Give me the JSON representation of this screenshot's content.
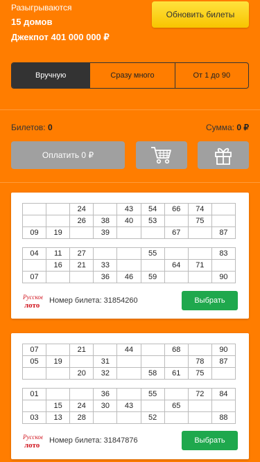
{
  "header": {
    "line1": "Разыгрываются",
    "line2": "15 домов",
    "line3": "Джекпот 401 000 000 ₽",
    "update_button": "Обновить билеты"
  },
  "modes": [
    {
      "label": "Вручную",
      "active": true
    },
    {
      "label": "Сразу много",
      "active": false
    },
    {
      "label": "От 1 до 90",
      "active": false
    }
  ],
  "summary": {
    "tickets_label": "Билетов:",
    "tickets_value": "0",
    "sum_label": "Сумма:",
    "sum_value": "0 ₽",
    "pay_button": "Оплатить 0 ₽",
    "cart_icon": "cart-icon",
    "gift_icon": "gift-icon"
  },
  "tickets": [
    {
      "number_label": "Номер билета: 31854260",
      "button": "Выбрать",
      "logo": "Русское лото",
      "grid1": [
        [
          "",
          "",
          "24",
          "",
          "43",
          "54",
          "66",
          "74",
          ""
        ],
        [
          "",
          "",
          "26",
          "38",
          "40",
          "53",
          "",
          "75",
          ""
        ],
        [
          "09",
          "19",
          "",
          "39",
          "",
          "",
          "67",
          "",
          "87"
        ]
      ],
      "grid2": [
        [
          "04",
          "11",
          "27",
          "",
          "",
          "55",
          "",
          "",
          "83"
        ],
        [
          "",
          "16",
          "21",
          "33",
          "",
          "",
          "64",
          "71",
          ""
        ],
        [
          "07",
          "",
          "",
          "36",
          "46",
          "59",
          "",
          "",
          "90"
        ]
      ]
    },
    {
      "number_label": "Номер билета: 31847876",
      "button": "Выбрать",
      "logo": "Русское лото",
      "grid1": [
        [
          "07",
          "",
          "21",
          "",
          "44",
          "",
          "68",
          "",
          "90"
        ],
        [
          "05",
          "19",
          "",
          "31",
          "",
          "",
          "",
          "78",
          "87"
        ],
        [
          "",
          "",
          "20",
          "32",
          "",
          "58",
          "61",
          "75",
          ""
        ]
      ],
      "grid2": [
        [
          "01",
          "",
          "",
          "36",
          "",
          "55",
          "",
          "72",
          "84"
        ],
        [
          "",
          "15",
          "24",
          "30",
          "43",
          "",
          "65",
          "",
          ""
        ],
        [
          "03",
          "13",
          "28",
          "",
          "",
          "52",
          "",
          "",
          "88"
        ]
      ]
    }
  ]
}
